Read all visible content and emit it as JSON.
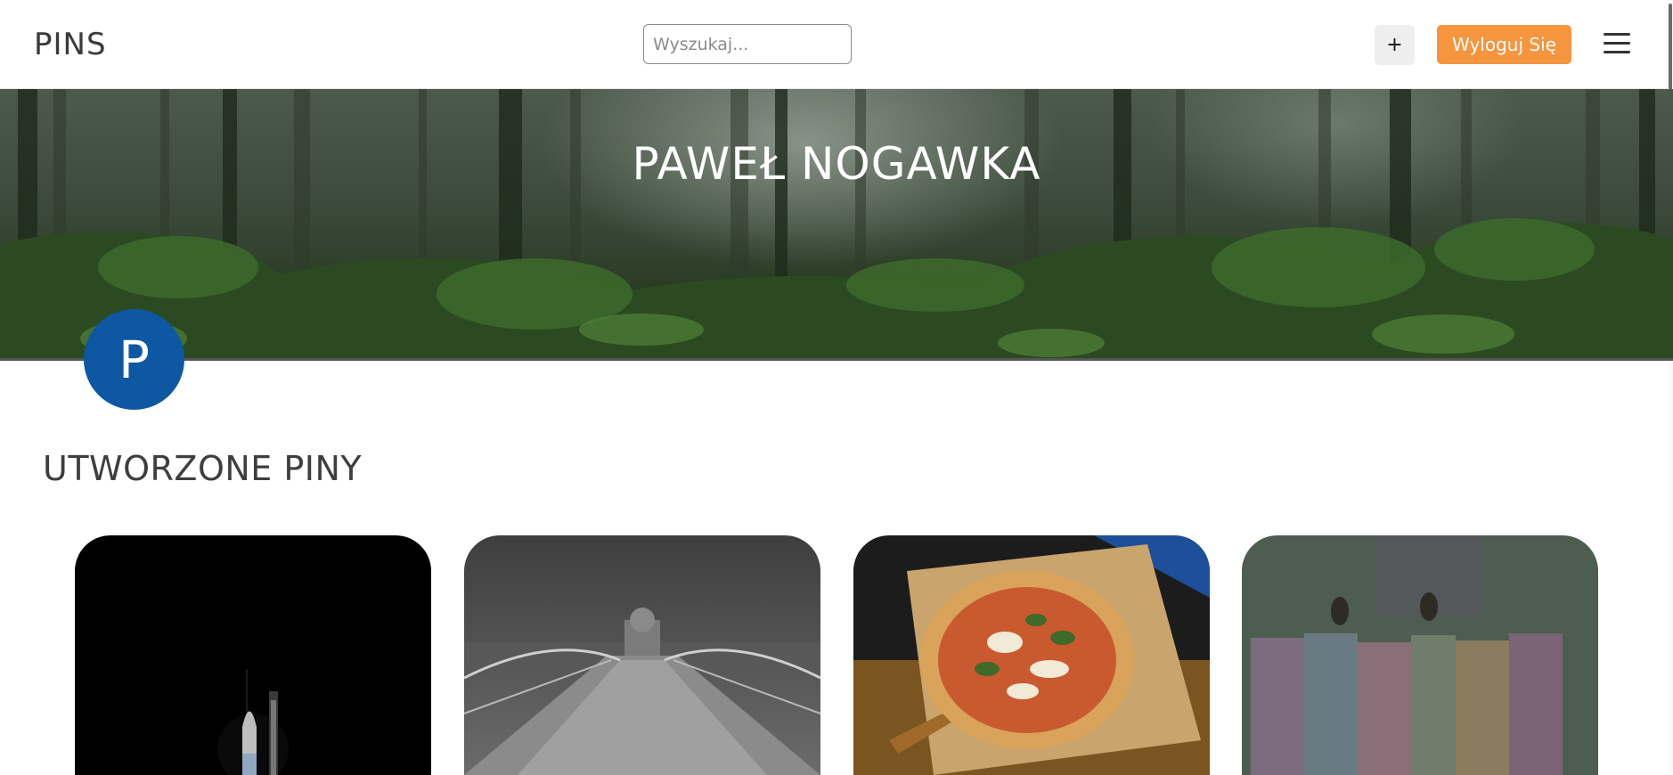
{
  "header": {
    "logo": "PINS",
    "search_placeholder": "Wyszukaj...",
    "add_label": "+",
    "logout_label": "Wyloguj Się",
    "menu_icon": "hamburger-menu-icon"
  },
  "profile": {
    "name": "PAWEŁ NOGAWKA",
    "avatar_letter": "P",
    "avatar_color": "#0d57a3"
  },
  "section": {
    "title": "UTWORZONE PINY"
  },
  "pins": [
    {
      "name": "pin-rocket-launch"
    },
    {
      "name": "pin-millennium-bridge"
    },
    {
      "name": "pin-pizza"
    },
    {
      "name": "pin-blurred-art"
    }
  ],
  "colors": {
    "accent": "#f5953e",
    "avatar": "#0d57a3"
  }
}
